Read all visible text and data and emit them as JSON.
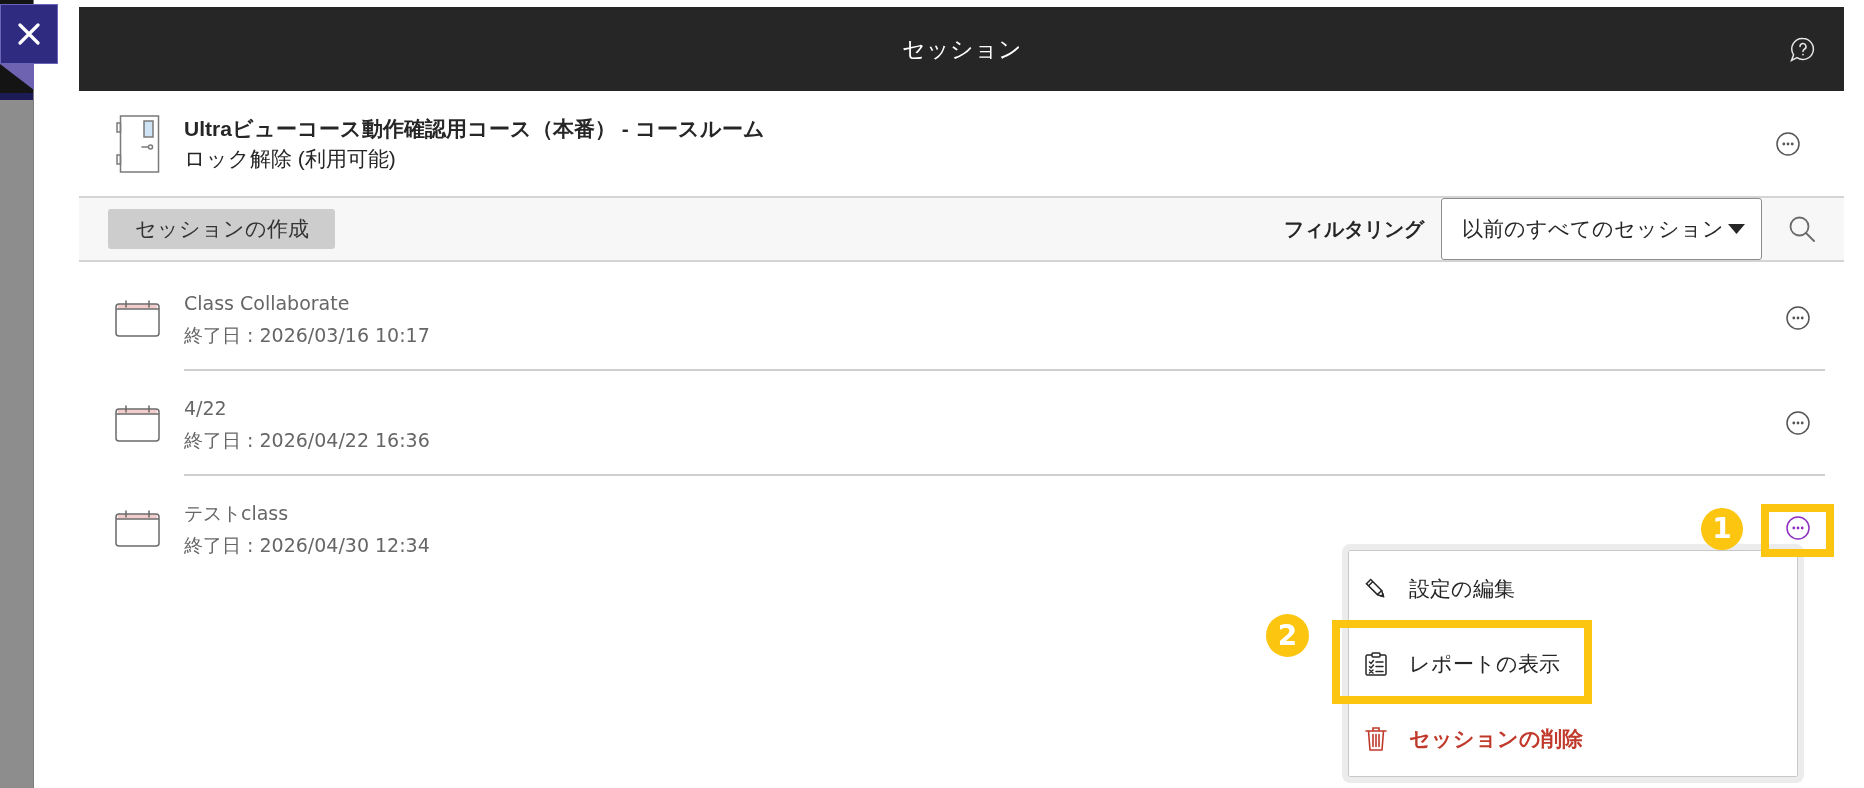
{
  "header": {
    "title": "セッション"
  },
  "course_room": {
    "title": "Ultraビューコース動作確認用コース（本番） - コースルーム",
    "status": "ロック解除 (利用可能)"
  },
  "toolbar": {
    "create_button": "セッションの作成",
    "filter_label": "フィルタリング",
    "filter_value": "以前のすべてのセッション"
  },
  "sessions": [
    {
      "title": "Class Collaborate",
      "end_date": "終了日 : 2026/03/16 10:17",
      "menu_open": false
    },
    {
      "title": "4/22",
      "end_date": "終了日 : 2026/04/22 16:36",
      "menu_open": false
    },
    {
      "title": "テストclass",
      "end_date": "終了日 : 2026/04/30 12:34",
      "menu_open": true,
      "callout": "1"
    }
  ],
  "menu": {
    "items": [
      {
        "kind": "edit",
        "label": "設定の編集"
      },
      {
        "kind": "report",
        "label": "レポートの表示",
        "callout": "2"
      },
      {
        "kind": "delete",
        "label": "セッションの削除"
      }
    ]
  }
}
